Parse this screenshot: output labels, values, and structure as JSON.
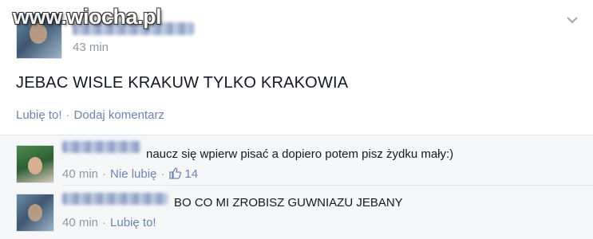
{
  "watermark": "www.wiocha.pl",
  "post": {
    "time": "43 min",
    "text": "JEBAC WISLE KRAKUW TYLKO KRAKOWIA",
    "actions": {
      "like": "Lubię to!",
      "separator": "·",
      "comment": "Dodaj komentarz"
    }
  },
  "comments": [
    {
      "text": "naucz się wpierw pisać a dopiero potem pisz żydku mały:)",
      "time": "40 min",
      "separator": "·",
      "action": "Nie lubię",
      "like_count": "14"
    },
    {
      "text": "BO CO MI ZROBISZ GUWNIAZU JEBANY",
      "time": "40 min",
      "separator": "·",
      "action": "Lubię to!"
    }
  ],
  "icons": {
    "menu": "chevron-down-icon",
    "like": "thumbs-up-icon"
  },
  "colors": {
    "link": "#6d84b4",
    "meta": "#9197a3",
    "text": "#141823",
    "comment_bg": "#f6f7f9"
  }
}
